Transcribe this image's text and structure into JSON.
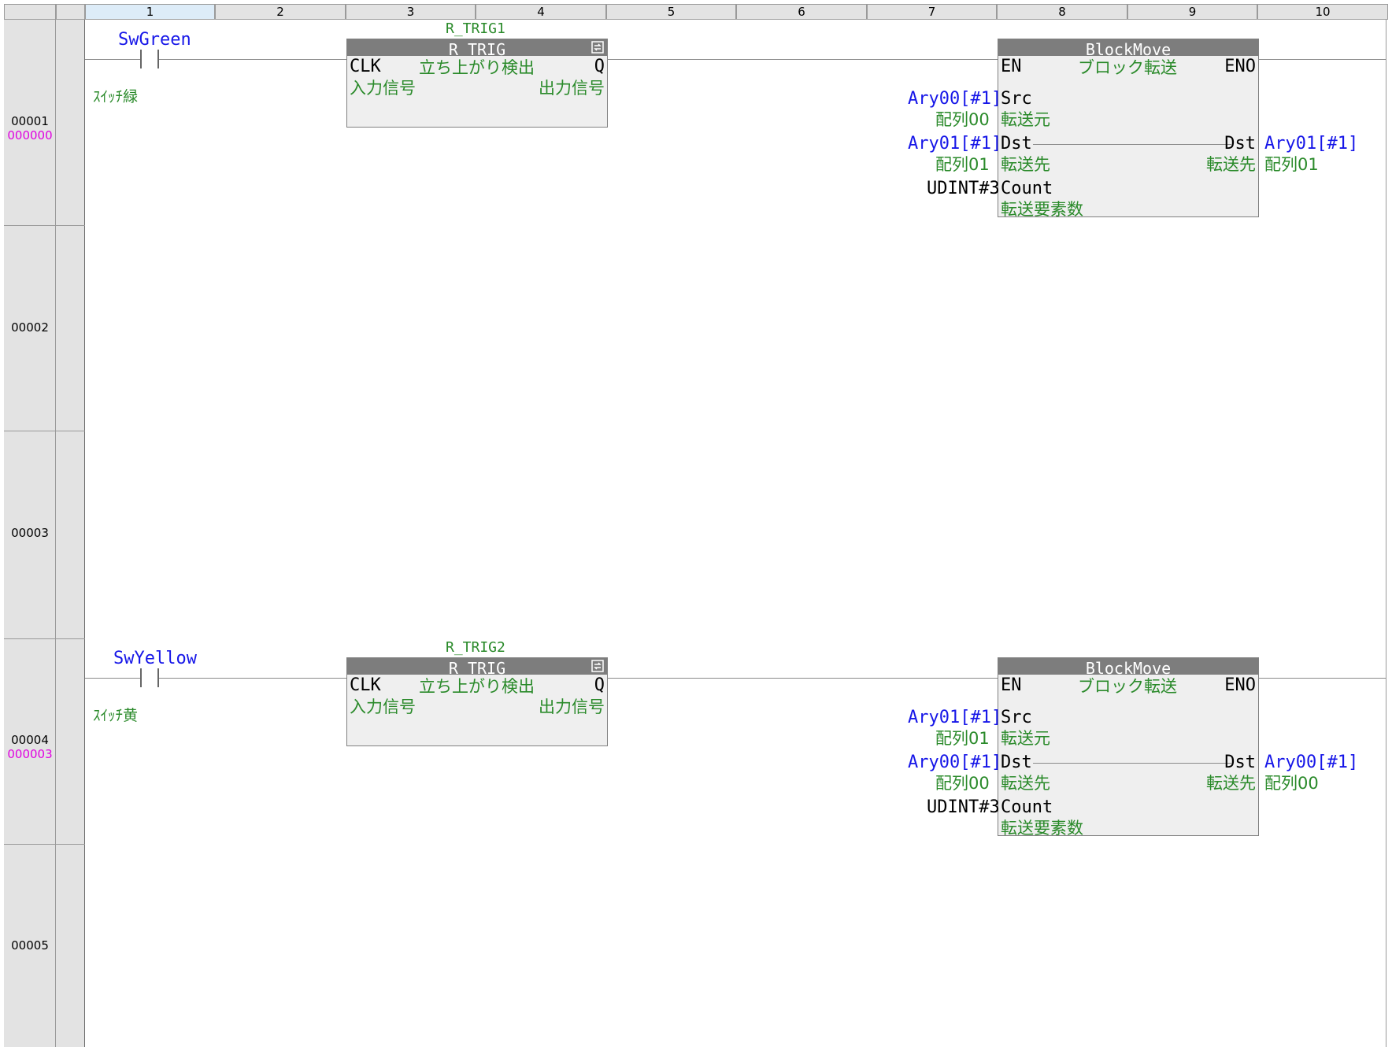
{
  "columns": [
    "1",
    "2",
    "3",
    "4",
    "5",
    "6",
    "7",
    "8",
    "9",
    "10"
  ],
  "rows": [
    {
      "number": "00001",
      "step": "000000"
    },
    {
      "number": "00002",
      "step": ""
    },
    {
      "number": "00003",
      "step": ""
    },
    {
      "number": "00004",
      "step": "000003"
    },
    {
      "number": "00005",
      "step": ""
    }
  ],
  "rung1": {
    "contact": {
      "name": "SwGreen",
      "comment": "ｽｲｯﾁ緑"
    },
    "rtrig": {
      "instance": "R_TRIG1",
      "type": "R_TRIG",
      "comment": "立ち上がり検出",
      "in_pin": "CLK",
      "in_comment": "入力信号",
      "out_pin": "Q",
      "out_comment": "出力信号"
    },
    "blockmove": {
      "type": "BlockMove",
      "comment": "ブロック転送",
      "en": "EN",
      "eno": "ENO",
      "src_pin": "Src",
      "src_comment": "転送元",
      "src_var": "Ary00[#1]",
      "src_var_comment": "配列00",
      "dst_pin": "Dst",
      "dst_comment": "転送先",
      "dst_var": "Ary01[#1]",
      "dst_var_comment": "配列01",
      "dst_out_pin": "Dst",
      "dst_out_comment": "転送先",
      "dst_out_var": "Ary01[#1]",
      "dst_out_var_comment": "配列01",
      "count_pin": "Count",
      "count_comment": "転送要素数",
      "count_value": "UDINT#3"
    }
  },
  "rung4": {
    "contact": {
      "name": "SwYellow",
      "comment": "ｽｲｯﾁ黄"
    },
    "rtrig": {
      "instance": "R_TRIG2",
      "type": "R_TRIG",
      "comment": "立ち上がり検出",
      "in_pin": "CLK",
      "in_comment": "入力信号",
      "out_pin": "Q",
      "out_comment": "出力信号"
    },
    "blockmove": {
      "type": "BlockMove",
      "comment": "ブロック転送",
      "en": "EN",
      "eno": "ENO",
      "src_pin": "Src",
      "src_comment": "転送元",
      "src_var": "Ary01[#1]",
      "src_var_comment": "配列01",
      "dst_pin": "Dst",
      "dst_comment": "転送先",
      "dst_var": "Ary00[#1]",
      "dst_var_comment": "配列00",
      "dst_out_pin": "Dst",
      "dst_out_comment": "転送先",
      "dst_out_var": "Ary00[#1]",
      "dst_out_var_comment": "配列00",
      "count_pin": "Count",
      "count_comment": "転送要素数",
      "count_value": "UDINT#3"
    }
  },
  "colors": {
    "variable": "#1616e8",
    "comment": "#2a8a2a",
    "step": "#e000e0",
    "fb_header": "#7d7d7d"
  }
}
